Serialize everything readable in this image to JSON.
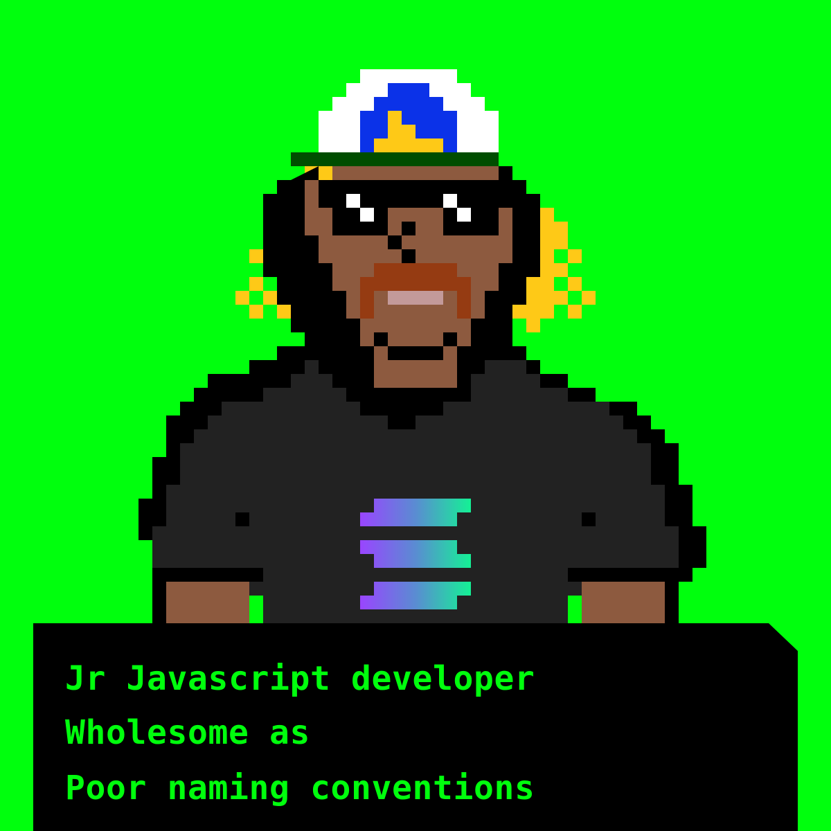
{
  "background_color": "#00ff0d",
  "avatar": {
    "style": "pixel-art",
    "palette": {
      "black": "#000000",
      "white": "#ffffff",
      "hat_blue": "#0b32e8",
      "hat_gold": "#fec917",
      "hat_brim": "#004d00",
      "skin": "#8d5a3f",
      "hair": "#fec917",
      "beard": "#953b12",
      "mouth": "#c39a9a",
      "shirt": "#222222",
      "logo_purple": "#9945ff",
      "logo_blue": "#5a8cd2",
      "logo_green": "#14f195"
    }
  },
  "caption": {
    "line1": "Jr Javascript developer",
    "line2": "Wholesome as",
    "line3": "Poor naming conventions",
    "text_color": "#00ff0d",
    "panel_color": "#000000"
  }
}
